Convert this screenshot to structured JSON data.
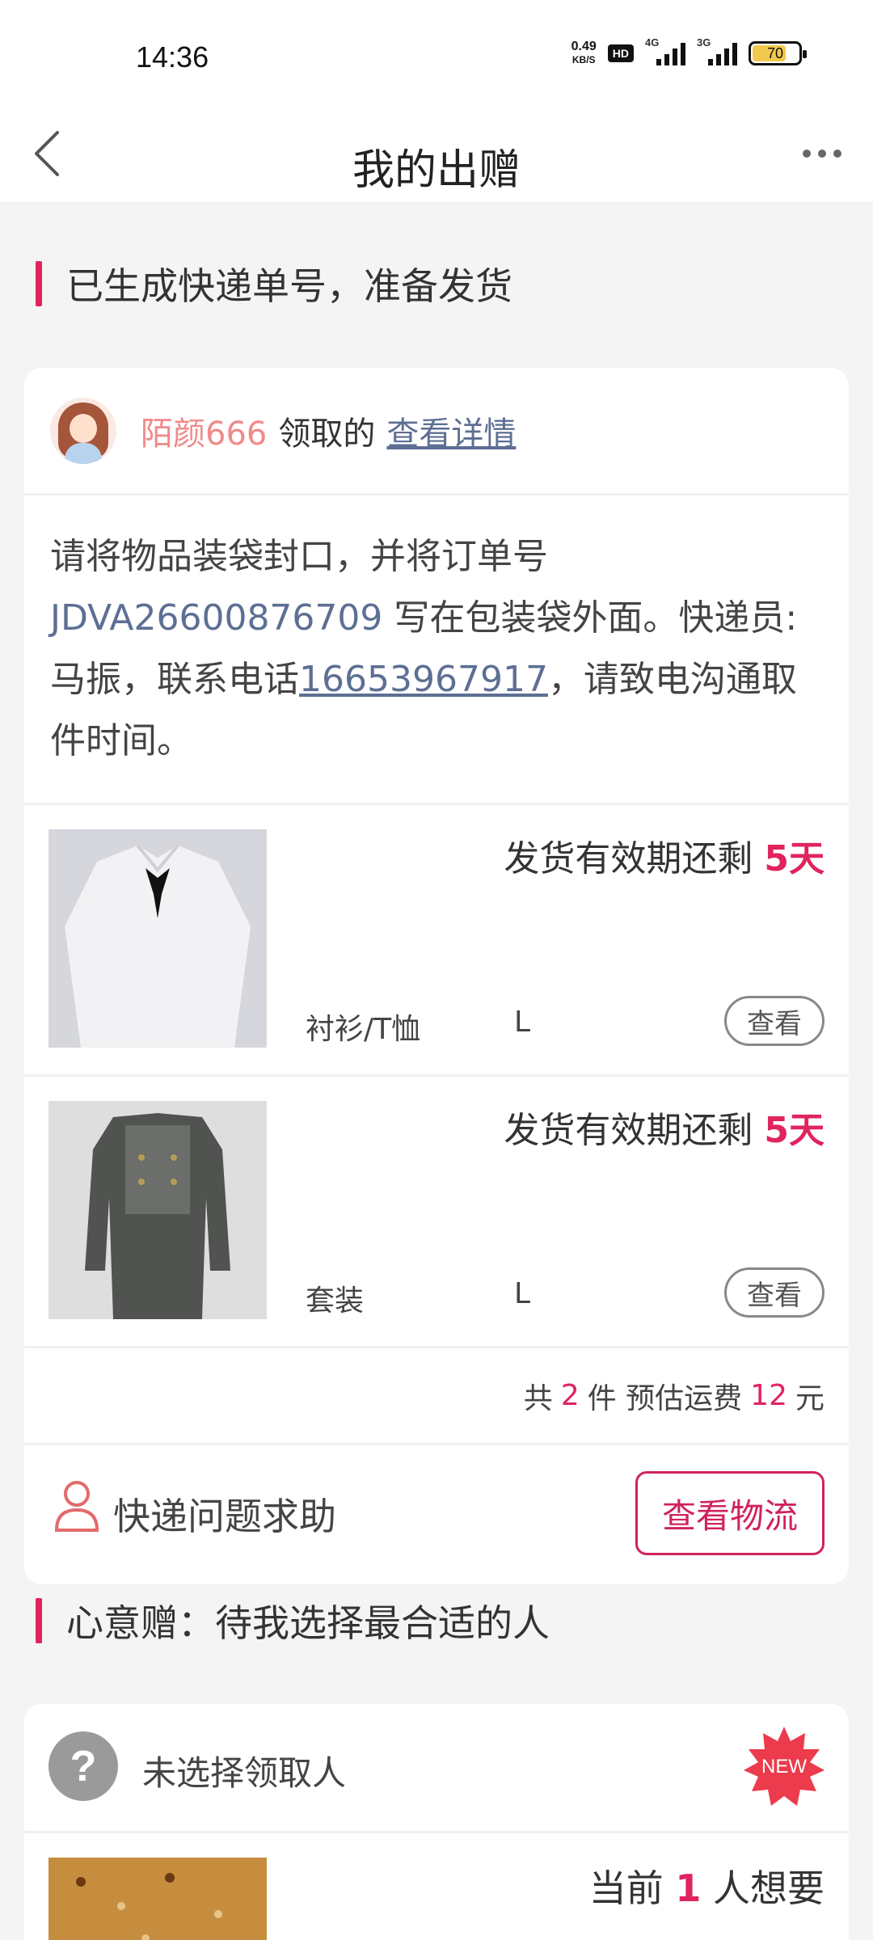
{
  "status_bar": {
    "time": "14:36",
    "net_speed_value": "0.49",
    "net_speed_unit": "KB/S",
    "hd_label": "HD",
    "sim1_label": "4G",
    "sim2_label": "3G",
    "battery_level": "70"
  },
  "header": {
    "title": "我的出赠"
  },
  "section1": {
    "title": "已生成快递单号，准备发货"
  },
  "order_card": {
    "claimer_name": "陌颜666",
    "claim_verb": "领取的",
    "detail_link": "查看详情",
    "instruction_prefix": "请将物品装袋封口，并将订单号 ",
    "order_number": "JDVA26600876709",
    "instruction_mid": " 写在包装袋外面。快递员:马振，联系电话",
    "phone": "16653967917",
    "instruction_suffix": "，请致电沟通取件时间。",
    "items": [
      {
        "deadline_prefix": "发货有效期还剩 ",
        "deadline_days": "5天",
        "category": "衬衫/T恤",
        "size": "L",
        "view_label": "查看"
      },
      {
        "deadline_prefix": "发货有效期还剩 ",
        "deadline_days": "5天",
        "category": "套装",
        "size": "L",
        "view_label": "查看"
      }
    ],
    "summary": {
      "total_prefix": "共",
      "total_count": "2",
      "total_unit": "件 预估运费",
      "fee": "12",
      "fee_unit": "元"
    },
    "help_label": "快递问题求助",
    "logistics_button": "查看物流"
  },
  "section2": {
    "title": "心意赠：待我选择最合适的人"
  },
  "gift_card": {
    "recipient_label": "未选择领取人",
    "new_badge": "NEW",
    "want_prefix": "当前 ",
    "want_count": "1",
    "want_suffix": " 人想要"
  },
  "colors": {
    "accent": "#e0245e",
    "link": "#5d6f93",
    "claimer": "#f08a8a"
  }
}
